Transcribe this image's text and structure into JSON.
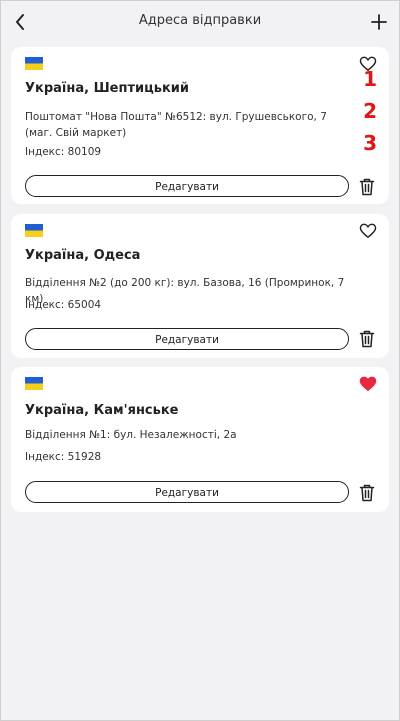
{
  "header": {
    "title": "Адреса відправки",
    "back_icon": "chevron-left-icon",
    "add_icon": "plus-icon"
  },
  "colors": {
    "heart_active": "#e8283c",
    "annotation": "#e01515",
    "flag_blue": "#1f5fd1",
    "flag_yellow": "#f6cf1c"
  },
  "addresses": [
    {
      "city": "Україна, Шептицький",
      "address": "Поштомат \"Нова Пошта\" №6512: вул. Грушевського, 7 (маг. Свій маркет)",
      "index": "Індекс: 80109",
      "edit_label": "Редагувати",
      "favorite": false
    },
    {
      "city": "Україна, Одеса",
      "address": "Відділення №2 (до 200 кг): вул. Базова, 16 (Промринок, 7 км)",
      "index": "Індекс: 65004",
      "edit_label": "Редагувати",
      "favorite": false
    },
    {
      "city": "Україна, Кам'янське",
      "address": "Відділення №1: бул. Незалежності, 2а",
      "index": "Індекс: 51928",
      "edit_label": "Редагувати",
      "favorite": true
    }
  ],
  "annotations": [
    "1",
    "2",
    "3"
  ]
}
